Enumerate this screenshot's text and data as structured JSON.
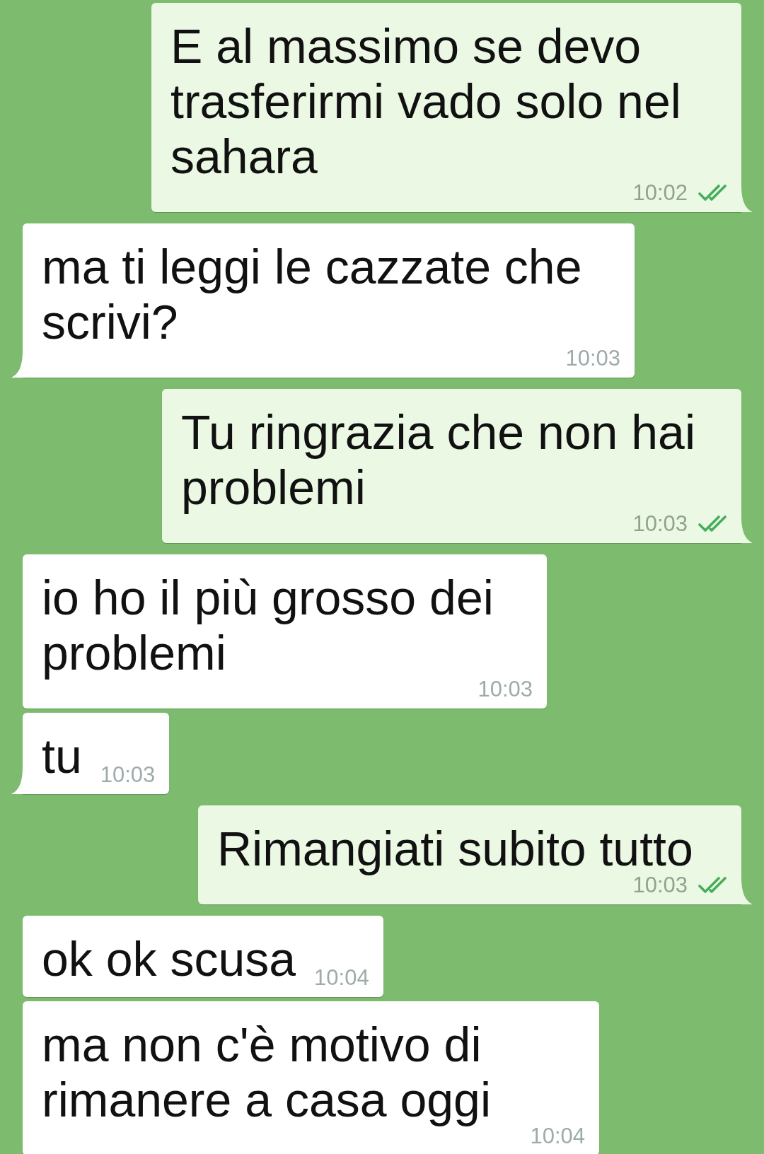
{
  "messages": [
    {
      "kind": "outgoing",
      "text": "E al massimo se devo trasferirmi vado solo nel sahara",
      "time": "10:02",
      "delivered": true,
      "tail": true
    },
    {
      "kind": "incoming",
      "text": "ma ti leggi le cazzate che scrivi?",
      "time": "10:03",
      "tail": true
    },
    {
      "kind": "outgoing",
      "text": "Tu ringrazia che non hai problemi",
      "time": "10:03",
      "delivered": true,
      "tail": true
    },
    {
      "kind": "incoming",
      "text": "io ho il più grosso dei problemi",
      "time": "10:03",
      "tail": false
    },
    {
      "kind": "incoming",
      "text": "tu",
      "time": "10:03",
      "tail": true
    },
    {
      "kind": "outgoing",
      "text": "Rimangiati subito tutto",
      "time": "10:03",
      "delivered": true,
      "tail": true
    },
    {
      "kind": "incoming",
      "text": "ok ok scusa",
      "time": "10:04",
      "tail": false
    },
    {
      "kind": "incoming",
      "text": "ma non c'è motivo di rimanere a casa oggi",
      "time": "10:04",
      "tail": false
    }
  ]
}
